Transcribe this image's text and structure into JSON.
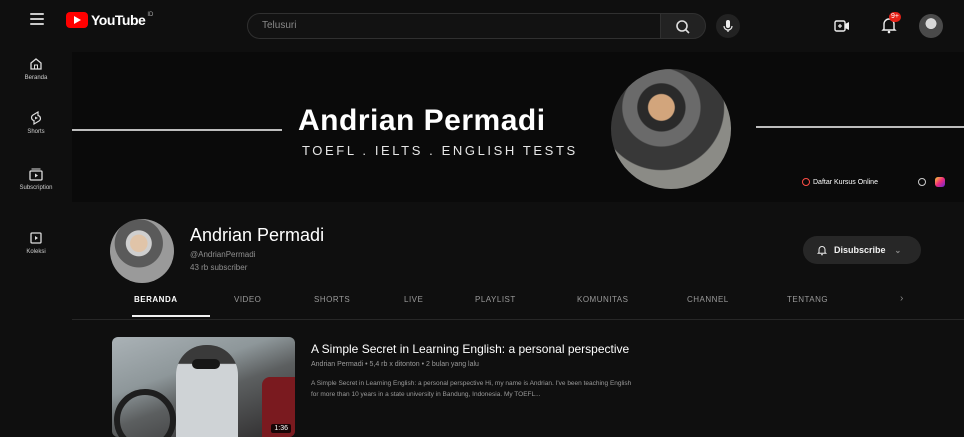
{
  "topbar": {
    "logo_text": "YouTube",
    "logo_country": "ID",
    "search_placeholder": "Telusuri",
    "notification_count": "9+"
  },
  "rail": [
    {
      "label": "Beranda",
      "icon": "home-icon"
    },
    {
      "label": "Shorts",
      "icon": "shorts-icon"
    },
    {
      "label": "Subscription",
      "icon": "subscriptions-icon"
    },
    {
      "label": "Koleksi",
      "icon": "library-icon"
    }
  ],
  "banner": {
    "title": "Andrian Permadi",
    "subtitle": "TOEFL . IELTS . ENGLISH TESTS",
    "link_label": "Daftar Kursus Online"
  },
  "channel": {
    "name": "Andrian Permadi",
    "handle": "@AndrianPermadi",
    "subscribers": "43 rb subscriber",
    "subscribe_label": "Disubscribe"
  },
  "tabs": [
    {
      "label": "BERANDA",
      "active": true
    },
    {
      "label": "VIDEO",
      "active": false
    },
    {
      "label": "SHORTS",
      "active": false
    },
    {
      "label": "LIVE",
      "active": false
    },
    {
      "label": "PLAYLIST",
      "active": false
    },
    {
      "label": "KOMUNITAS",
      "active": false
    },
    {
      "label": "CHANNEL",
      "active": false
    },
    {
      "label": "TENTANG",
      "active": false
    }
  ],
  "video": {
    "title": "A Simple Secret in Learning English: a personal perspective",
    "meta": "Andrian Permadi • 5,4 rb x ditonton • 2 bulan yang lalu",
    "description_line1": "A Simple Secret in Learning English: a personal perspective Hi, my name is Andrian. I've been teaching English",
    "description_line2": "for more than 10 years in a state university in Bandung, Indonesia. My TOEFL...",
    "duration": "1:36"
  },
  "colors": {
    "background": "#0f0f0f",
    "brand_red": "#ff0000",
    "text_primary": "#f1f1f1",
    "text_secondary": "#9a9a9a"
  }
}
